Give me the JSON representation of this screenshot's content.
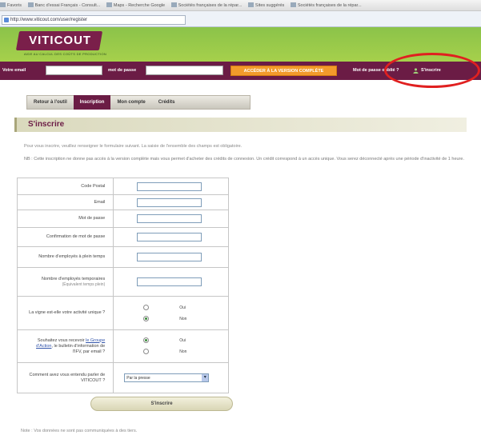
{
  "browser": {
    "favorites": [
      "Favoris",
      "Banc d'essai Français - Consult...",
      "Maps - Recherche Google",
      "Sociétés françaises de la répar...",
      "Sites suggérés",
      "Sociétés françaises de la répar..."
    ],
    "url": "http://www.viticout.com/user/register"
  },
  "site": {
    "logo": "VITICOUT",
    "tagline": "AIDE AU CALCUL DES COÛTS DE PRODUCTION"
  },
  "login": {
    "email_label": "Votre email",
    "password_label": "mot de passe",
    "full_version_button": "ACCÉDER À LA VERSION COMPLÈTE",
    "forgot_link": "Mot de passe oublié ?",
    "register_link": "S'inscrire"
  },
  "tabs": [
    "Retour à l'outil",
    "Inscription",
    "Mon compte",
    "Crédits"
  ],
  "active_tab": 1,
  "page": {
    "title": "S'inscrire",
    "intro": "Pour vous inscrire, veuillez renseigner le formulaire suivant. La saisie de l'ensemble des champs est obligatoire.",
    "nb": "NB : Cette inscription ne donne pas accès à la version complète mais vous permet d'acheter des crédits de connexion. Un crédit correspond à un accès unique. Vous serez déconnecté après une période d'inactivité de 1 heure."
  },
  "form": {
    "code_postal": "Code Postal",
    "email": "Email",
    "mot_de_passe": "Mot de passe",
    "confirmation": "Confirmation de mot de passe",
    "employes_plein": "Nombre d'employés à plein temps",
    "employes_temp": "Nombre d'employés temporaires",
    "employes_temp_sub": "(Équivalent temps plein)",
    "vigne_q": "La vigne est-elle votre activité unique ?",
    "newsletter_pre": "Souhaitez vous recevoir",
    "newsletter_link": "le Groupe d'Action",
    "newsletter_post": ", le bulletin d'information de l'IFV, par email ?",
    "oui": "Oui",
    "non": "Non",
    "source_q": "Comment avez vous entendu parler de VITICOUT ?",
    "source_value": "Par la presse",
    "submit": "S'inscrire"
  },
  "note": "Note : Vos données ne sont pas communiquées à des tiers."
}
